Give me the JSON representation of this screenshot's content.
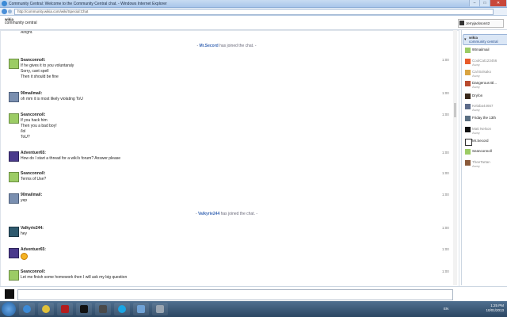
{
  "window": {
    "title": "Community Central: Welcome to the Community Central chat. - Windows Internet Explorer",
    "minimize": "–",
    "maximize": "□",
    "close": "✕"
  },
  "address": {
    "url": "http://community.wikia.com/wiki/Special:Chat"
  },
  "header": {
    "logo_top": "wikia",
    "logo_bottom": "community central",
    "username": "Jerryjackson42"
  },
  "chat": {
    "cut_text": "Alright.",
    "joins": [
      {
        "name": "Mr.Secord",
        "text": "has joined the chat."
      },
      {
        "name": "Valkyrie244",
        "text": "has joined the chat."
      }
    ],
    "messages": [
      {
        "user": "Seanconnoll:",
        "time": "1:00",
        "lines": [
          "If he gives it to you voluntaraly",
          "Sorry, cant spell",
          "Then it should be fine"
        ]
      },
      {
        "user": "90mailmail:",
        "time": "1:00",
        "lines": [
          "oh mm it is most likely violating ToU"
        ]
      },
      {
        "user": "Seanconnoll:",
        "time": "1:00",
        "lines": [
          "If you hack him",
          "Then you a bad boy!",
          "/lol",
          "ToU?"
        ]
      },
      {
        "user": "Adventuer65:",
        "time": "1:00",
        "lines": [
          "How do I start a thread for a wiki's forum? Answer please"
        ]
      },
      {
        "user": "Seanconnoll:",
        "time": "1:00",
        "lines": [
          "Terms of Use?"
        ]
      },
      {
        "user": "90mailmail:",
        "time": "1:00",
        "lines": [
          "yep"
        ]
      },
      {
        "user": "Valkyrie244:",
        "time": "1:00",
        "lines": [
          "hey"
        ]
      },
      {
        "user": "Adventuer65:",
        "time": "1:00",
        "lines": [
          ""
        ]
      },
      {
        "user": "Seanconnoll:",
        "time": "1:00",
        "lines": [
          "Let me finish some homework then I will ask my big question"
        ]
      }
    ]
  },
  "sidebar": {
    "wiki_top": "wikia",
    "wiki_name": "community central",
    "collapse": "▾",
    "users": [
      {
        "name": "90mailmail",
        "status": ""
      },
      {
        "name": "CoolCat123456",
        "status": "Away"
      },
      {
        "name": "Cal Bolsako",
        "status": "Away"
      },
      {
        "name": "Dangerous Bl...",
        "status": "Away"
      },
      {
        "name": "Dryfon",
        "status": ""
      },
      {
        "name": "Kelaba44667",
        "status": "Away"
      },
      {
        "name": "Friday the 13th",
        "status": ""
      },
      {
        "name": "Matt Nelson",
        "status": "Away"
      },
      {
        "name": "Mr.Secord",
        "status": ""
      },
      {
        "name": "Seanconnoll",
        "status": ""
      },
      {
        "name": "TheeTartan",
        "status": "Away"
      }
    ]
  },
  "taskbar": {
    "lang": "EN",
    "time": "1:25 PM",
    "date": "10/01/2013"
  }
}
